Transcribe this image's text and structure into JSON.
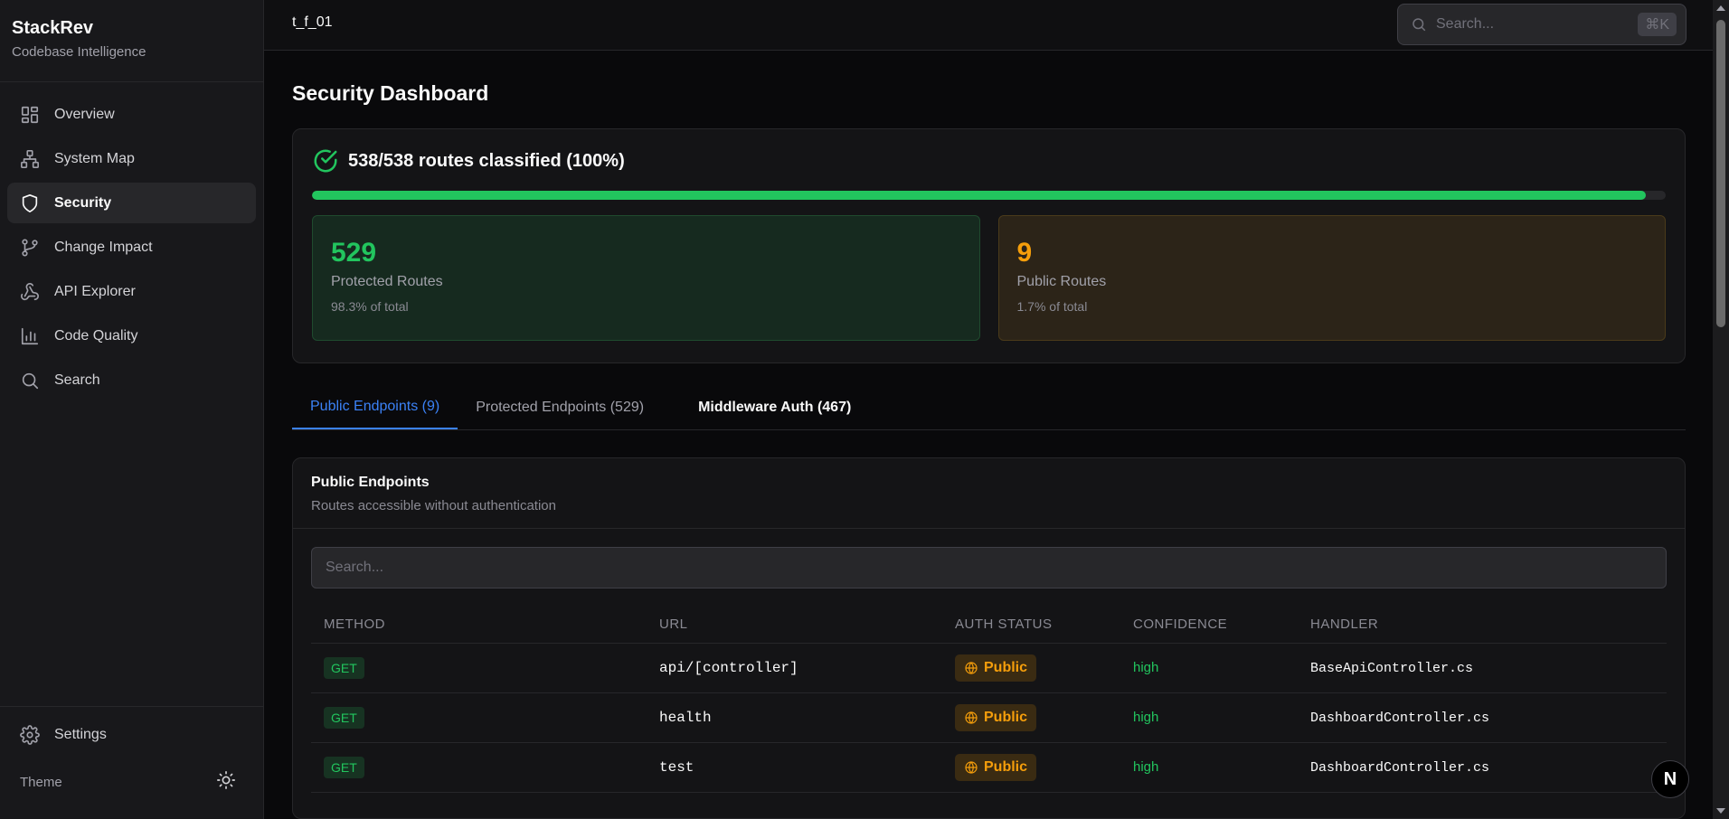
{
  "brand": {
    "title": "StackRev",
    "subtitle": "Codebase Intelligence"
  },
  "sidebar": {
    "items": [
      {
        "label": "Overview",
        "icon": "layout-grid-icon"
      },
      {
        "label": "System Map",
        "icon": "network-icon"
      },
      {
        "label": "Security",
        "icon": "shield-icon",
        "active": true
      },
      {
        "label": "Change Impact",
        "icon": "git-branch-icon"
      },
      {
        "label": "API Explorer",
        "icon": "webhook-icon"
      },
      {
        "label": "Code Quality",
        "icon": "bar-chart-icon"
      },
      {
        "label": "Search",
        "icon": "search-icon"
      }
    ],
    "settings_label": "Settings",
    "theme_label": "Theme"
  },
  "topbar": {
    "project": "t_f_01",
    "search_placeholder": "Search...",
    "shortcut": "⌘K"
  },
  "page": {
    "title": "Security Dashboard"
  },
  "summary": {
    "headline": "538/538 routes classified (100%)",
    "progress_fraction": 0.985,
    "protected": {
      "value": "529",
      "label": "Protected Routes",
      "sub": "98.3% of total"
    },
    "public": {
      "value": "9",
      "label": "Public Routes",
      "sub": "1.7% of total"
    }
  },
  "tabs": [
    {
      "label": "Public Endpoints (9)"
    },
    {
      "label": "Protected Endpoints (529)"
    },
    {
      "label": "Middleware Auth (467)"
    }
  ],
  "endpoints": {
    "title": "Public Endpoints",
    "description": "Routes accessible without authentication",
    "search_placeholder": "Search...",
    "columns": [
      "METHOD",
      "URL",
      "AUTH STATUS",
      "CONFIDENCE",
      "HANDLER"
    ],
    "rows": [
      {
        "method": "GET",
        "url": "api/[controller]",
        "auth": "Public",
        "confidence": "high",
        "handler": "BaseApiController.cs"
      },
      {
        "method": "GET",
        "url": "health",
        "auth": "Public",
        "confidence": "high",
        "handler": "DashboardController.cs"
      },
      {
        "method": "GET",
        "url": "test",
        "auth": "Public",
        "confidence": "high",
        "handler": "DashboardController.cs"
      }
    ]
  },
  "colors": {
    "accent": "#3b82f6",
    "success": "#22c55e",
    "warning": "#f59e0b"
  },
  "fab": {
    "label": "N"
  }
}
